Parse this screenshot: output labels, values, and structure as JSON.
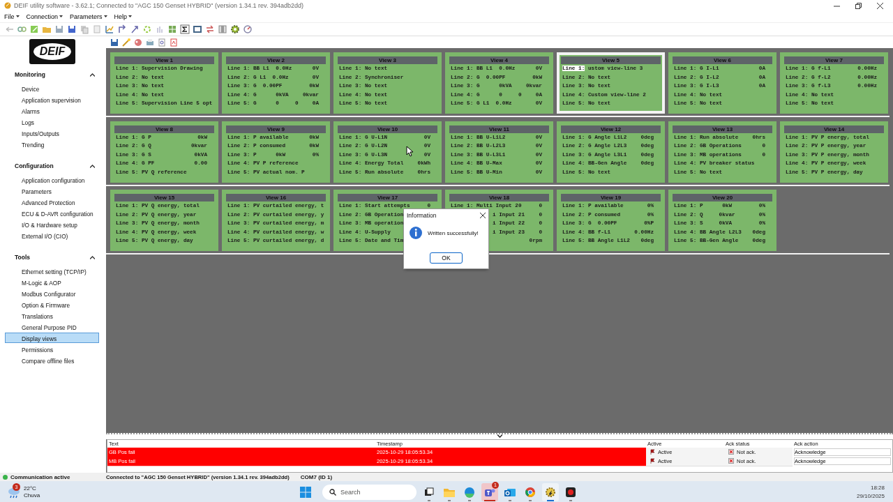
{
  "window": {
    "title": "DEIF utility software - 3.62.1; Connected to \"AGC 150 Genset HYBRID\" (version 1.34.1 rev. 394adb2dd)"
  },
  "menu": [
    "File",
    "Connection",
    "Parameters",
    "Help"
  ],
  "sidebar": {
    "logo": "DEIF",
    "sections": [
      {
        "title": "Monitoring",
        "expanded": true,
        "items": [
          {
            "label": "Device",
            "selected": false
          },
          {
            "label": "Application supervision",
            "selected": false
          },
          {
            "label": "Alarms",
            "selected": false
          },
          {
            "label": "Logs",
            "selected": false
          },
          {
            "label": "Inputs/Outputs",
            "selected": false
          },
          {
            "label": "Trending",
            "selected": false
          }
        ]
      },
      {
        "title": "Configuration",
        "expanded": true,
        "items": [
          {
            "label": "Application configuration",
            "selected": false
          },
          {
            "label": "Parameters",
            "selected": false
          },
          {
            "label": "Advanced Protection",
            "selected": false
          },
          {
            "label": "ECU & D-AVR configuration",
            "selected": false
          },
          {
            "label": "I/O & Hardware setup",
            "selected": false
          },
          {
            "label": "External I/O (CIO)",
            "selected": false
          }
        ]
      },
      {
        "title": "Tools",
        "expanded": true,
        "items": [
          {
            "label": "Ethernet setting (TCP/IP)",
            "selected": false
          },
          {
            "label": "M-Logic & AOP",
            "selected": false
          },
          {
            "label": "Modbus Configurator",
            "selected": false
          },
          {
            "label": "Option & Firmware",
            "selected": false
          },
          {
            "label": "Translations",
            "selected": false
          },
          {
            "label": "General Purpose PID",
            "selected": false
          },
          {
            "label": "Display views",
            "selected": true
          },
          {
            "label": "Permissions",
            "selected": false
          },
          {
            "label": "Compare offline files",
            "selected": false
          }
        ]
      }
    ]
  },
  "view_rows": [
    [
      {
        "title": "View 1",
        "selected": false,
        "lines": [
          {
            "label": "Line 1:",
            "text": "Supervision Drawing",
            "selected": false
          },
          {
            "label": "Line 2:",
            "text": "No text",
            "selected": false
          },
          {
            "label": "Line 3:",
            "text": "No text",
            "selected": false
          },
          {
            "label": "Line 4:",
            "text": "No text",
            "selected": false
          },
          {
            "label": "Line 5:",
            "text": "Supervision Line 5 opt",
            "selected": false
          }
        ]
      },
      {
        "title": "View 2",
        "selected": false,
        "lines": [
          {
            "label": "Line 1:",
            "text": "BB L1  0.0Hz",
            "value": "0V",
            "selected": false
          },
          {
            "label": "Line 2:",
            "text": "G L1  0.0Hz",
            "value": "0V",
            "selected": false
          },
          {
            "label": "Line 3:",
            "text": "G  0.00PF",
            "value": "0kW",
            "selected": false
          },
          {
            "label": "Line 4:",
            "text": "G      0kVA",
            "value": "0kvar",
            "selected": false
          },
          {
            "label": "Line 5:",
            "text": "G      0     0",
            "value": "0A",
            "selected": false
          }
        ]
      },
      {
        "title": "View 3",
        "selected": false,
        "lines": [
          {
            "label": "Line 1:",
            "text": "No text",
            "selected": false
          },
          {
            "label": "Line 2:",
            "text": "Synchroniser",
            "selected": false
          },
          {
            "label": "Line 3:",
            "text": "No text",
            "selected": false
          },
          {
            "label": "Line 4:",
            "text": "No text",
            "selected": false
          },
          {
            "label": "Line 5:",
            "text": "No text",
            "selected": false
          }
        ]
      },
      {
        "title": "View 4",
        "selected": false,
        "lines": [
          {
            "label": "Line 1:",
            "text": "BB L1  0.0Hz",
            "value": "0V",
            "selected": false
          },
          {
            "label": "Line 2:",
            "text": "G  0.00PF",
            "value": "0kW",
            "selected": false
          },
          {
            "label": "Line 3:",
            "text": "G      0kVA",
            "value": "0kvar",
            "selected": false
          },
          {
            "label": "Line 4:",
            "text": "G      0     0",
            "value": "0A",
            "selected": false
          },
          {
            "label": "Line 5:",
            "text": "G L1  0.0Hz",
            "value": "0V",
            "selected": false
          }
        ]
      },
      {
        "title": "View 5",
        "selected": true,
        "lines": [
          {
            "label": "Line 1:",
            "text": "ustom view-line 3",
            "selected": true
          },
          {
            "label": "Line 2:",
            "text": "No text",
            "selected": false
          },
          {
            "label": "Line 3:",
            "text": "No text",
            "selected": false
          },
          {
            "label": "Line 4:",
            "text": "Custom view-line 2",
            "selected": false
          },
          {
            "label": "Line 5:",
            "text": "No text",
            "selected": false
          }
        ]
      },
      {
        "title": "View 6",
        "selected": false,
        "lines": [
          {
            "label": "Line 1:",
            "text": "G I-L1",
            "value": "0A",
            "selected": false
          },
          {
            "label": "Line 2:",
            "text": "G I-L2",
            "value": "0A",
            "selected": false
          },
          {
            "label": "Line 3:",
            "text": "G I-L3",
            "value": "0A",
            "selected": false
          },
          {
            "label": "Line 4:",
            "text": "No text",
            "selected": false
          },
          {
            "label": "Line 5:",
            "text": "No text",
            "selected": false
          }
        ]
      },
      {
        "title": "View 7",
        "selected": false,
        "lines": [
          {
            "label": "Line 1:",
            "text": "G f-L1",
            "value": "0.00Hz",
            "selected": false
          },
          {
            "label": "Line 2:",
            "text": "G f-L2",
            "value": "0.00Hz",
            "selected": false
          },
          {
            "label": "Line 3:",
            "text": "G f-L3",
            "value": "0.00Hz",
            "selected": false
          },
          {
            "label": "Line 4:",
            "text": "No text",
            "selected": false
          },
          {
            "label": "Line 5:",
            "text": "No text",
            "selected": false
          }
        ]
      }
    ],
    [
      {
        "title": "View 8",
        "selected": false,
        "lines": [
          {
            "label": "Line 1:",
            "text": "G P",
            "value": "0kW",
            "selected": false
          },
          {
            "label": "Line 2:",
            "text": "G Q",
            "value": "0kvar",
            "selected": false
          },
          {
            "label": "Line 3:",
            "text": "G S",
            "value": "0kVA",
            "selected": false
          },
          {
            "label": "Line 4:",
            "text": "G PF",
            "value": "0.00",
            "selected": false
          },
          {
            "label": "Line 5:",
            "text": "PV Q reference",
            "selected": false
          }
        ]
      },
      {
        "title": "View 9",
        "selected": false,
        "lines": [
          {
            "label": "Line 1:",
            "text": "P available",
            "value": "0kW",
            "selected": false
          },
          {
            "label": "Line 2:",
            "text": "P consumed",
            "value": "0kW",
            "selected": false
          },
          {
            "label": "Line 3:",
            "text": "P      0kW",
            "value": "0%",
            "selected": false
          },
          {
            "label": "Line 4:",
            "text": "PV P reference",
            "selected": false
          },
          {
            "label": "Line 5:",
            "text": "PV actual nom. P",
            "selected": false
          }
        ]
      },
      {
        "title": "View 10",
        "selected": false,
        "lines": [
          {
            "label": "Line 1:",
            "text": "G U-L1N",
            "value": "0V",
            "selected": false
          },
          {
            "label": "Line 2:",
            "text": "G U-L2N",
            "value": "0V",
            "selected": false
          },
          {
            "label": "Line 3:",
            "text": "G U-L3N",
            "value": "0V",
            "selected": false
          },
          {
            "label": "Line 4:",
            "text": "Energy Total",
            "value": "0kWh",
            "selected": false
          },
          {
            "label": "Line 5:",
            "text": "Run absolute",
            "value": "0hrs",
            "selected": false
          }
        ]
      },
      {
        "title": "View 11",
        "selected": false,
        "lines": [
          {
            "label": "Line 1:",
            "text": "BB U-L1L2",
            "value": "0V",
            "selected": false
          },
          {
            "label": "Line 2:",
            "text": "BB U-L2L3",
            "value": "0V",
            "selected": false
          },
          {
            "label": "Line 3:",
            "text": "BB U-L3L1",
            "value": "0V",
            "selected": false
          },
          {
            "label": "Line 4:",
            "text": "BB U-Max",
            "value": "0V",
            "selected": false
          },
          {
            "label": "Line 5:",
            "text": "BB U-Min",
            "value": "0V",
            "selected": false
          }
        ]
      },
      {
        "title": "View 12",
        "selected": false,
        "lines": [
          {
            "label": "Line 1:",
            "text": "G Angle L1L2",
            "value": "0deg",
            "selected": false
          },
          {
            "label": "Line 2:",
            "text": "G Angle L2L3",
            "value": "0deg",
            "selected": false
          },
          {
            "label": "Line 3:",
            "text": "G Angle L3L1",
            "value": "0deg",
            "selected": false
          },
          {
            "label": "Line 4:",
            "text": "BB-Gen Angle",
            "value": "0deg",
            "selected": false
          },
          {
            "label": "Line 5:",
            "text": "No text",
            "selected": false
          }
        ]
      },
      {
        "title": "View 13",
        "selected": false,
        "lines": [
          {
            "label": "Line 1:",
            "text": "Run absolute",
            "value": "0hrs",
            "selected": false
          },
          {
            "label": "Line 2:",
            "text": "GB Operations",
            "value": "0",
            "selected": false
          },
          {
            "label": "Line 3:",
            "text": "MB operations",
            "value": "0",
            "selected": false
          },
          {
            "label": "Line 4:",
            "text": "PV breaker status",
            "selected": false
          },
          {
            "label": "Line 5:",
            "text": "No text",
            "selected": false
          }
        ]
      },
      {
        "title": "View 14",
        "selected": false,
        "lines": [
          {
            "label": "Line 1:",
            "text": "PV P energy, total",
            "selected": false
          },
          {
            "label": "Line 2:",
            "text": "PV P energy, year",
            "selected": false
          },
          {
            "label": "Line 3:",
            "text": "PV P energy, month",
            "selected": false
          },
          {
            "label": "Line 4:",
            "text": "PV P energy, week",
            "selected": false
          },
          {
            "label": "Line 5:",
            "text": "PV P energy, day",
            "selected": false
          }
        ]
      }
    ],
    [
      {
        "title": "View 15",
        "selected": false,
        "lines": [
          {
            "label": "Line 1:",
            "text": "PV Q energy, total",
            "selected": false
          },
          {
            "label": "Line 2:",
            "text": "PV Q energy, year",
            "selected": false
          },
          {
            "label": "Line 3:",
            "text": "PV Q energy, month",
            "selected": false
          },
          {
            "label": "Line 4:",
            "text": "PV Q energy, week",
            "selected": false
          },
          {
            "label": "Line 5:",
            "text": "PV Q energy, day",
            "selected": false
          }
        ]
      },
      {
        "title": "View 16",
        "selected": false,
        "lines": [
          {
            "label": "Line 1:",
            "text": "PV curtailed energy, t",
            "selected": false
          },
          {
            "label": "Line 2:",
            "text": "PV curtailed energy, y",
            "selected": false
          },
          {
            "label": "Line 3:",
            "text": "PV curtailed energy, m",
            "selected": false
          },
          {
            "label": "Line 4:",
            "text": "PV curtailed energy, w",
            "selected": false
          },
          {
            "label": "Line 5:",
            "text": "PV curtailed energy, d",
            "selected": false
          }
        ]
      },
      {
        "title": "View 17",
        "selected": false,
        "lines": [
          {
            "label": "Line 1:",
            "text": "Start attempts",
            "value": "0",
            "selected": false
          },
          {
            "label": "Line 2:",
            "text": "GB Operation",
            "selected": false
          },
          {
            "label": "Line 3:",
            "text": "MB operation",
            "selected": false
          },
          {
            "label": "Line 4:",
            "text": "U-Supply",
            "selected": false
          },
          {
            "label": "Line 5:",
            "text": "Date and Tim",
            "selected": false
          }
        ]
      },
      {
        "title": "View 18",
        "selected": false,
        "lines": [
          {
            "label": "Line 1:",
            "text": "Multi Input 20",
            "value": "0",
            "selected": false
          },
          {
            "text": "i Input 21",
            "value": "0",
            "selected": false
          },
          {
            "text": "i Input 22",
            "value": "0",
            "selected": false
          },
          {
            "text": "i Input 23",
            "value": "0",
            "selected": false
          },
          {
            "value": "0rpm",
            "selected": false
          }
        ]
      },
      {
        "title": "View 19",
        "selected": false,
        "lines": [
          {
            "label": "Line 1:",
            "text": "P available",
            "value": "0%",
            "selected": false
          },
          {
            "label": "Line 2:",
            "text": "P consumed",
            "value": "0%",
            "selected": false
          },
          {
            "label": "Line 3:",
            "text": "G  0.00PF",
            "value": "0%P",
            "selected": false
          },
          {
            "label": "Line 4:",
            "text": "BB f-L1",
            "value": "0.00Hz",
            "selected": false
          },
          {
            "label": "Line 5:",
            "text": "BB Angle L1L2",
            "value": "0deg",
            "selected": false
          }
        ]
      },
      {
        "title": "View 20",
        "selected": false,
        "lines": [
          {
            "label": "Line 1:",
            "text": "P      0kW",
            "value": "0%",
            "selected": false
          },
          {
            "label": "Line 2:",
            "text": "Q     0kvar",
            "value": "0%",
            "selected": false
          },
          {
            "label": "Line 3:",
            "text": "S     0kVA",
            "value": "0%",
            "selected": false
          },
          {
            "label": "Line 4:",
            "text": "BB Angle L2L3",
            "value": "0deg",
            "selected": false
          },
          {
            "label": "Line 5:",
            "text": "BB-Gen Angle",
            "value": "0deg",
            "selected": false
          }
        ]
      }
    ]
  ],
  "dialog": {
    "title": "Information",
    "message": "Written successfully!",
    "button": "OK"
  },
  "alarms": {
    "columns": [
      "Text",
      "Timestamp",
      "Active",
      "Ack status",
      "Ack action"
    ],
    "rows": [
      {
        "text": "GB Pos fail",
        "timestamp": "2025-10-29 18:05:53.34",
        "active": "Active",
        "ack_status": "Not ack.",
        "action": "Acknowledge",
        "acknowledged": false
      },
      {
        "text": "MB Pos fail",
        "timestamp": "2025-10-29 18:05:53.34",
        "active": "Active",
        "ack_status": "Not ack.",
        "action": "Acknowledge",
        "acknowledged": false
      }
    ]
  },
  "status_bar": {
    "communication": "Communication active",
    "connected": true,
    "connection": "Connected to \"AGC 150 Genset HYBRID\" (version 1.34.1 rev. 394adb2dd)",
    "port": "COM7 (ID 1)"
  },
  "taskbar": {
    "weather": {
      "temperature": "22°C",
      "condition": "Chuva",
      "badge": "3"
    },
    "search": {
      "placeholder": "Search"
    },
    "apps": [
      {
        "kind": "taskview",
        "selected": false,
        "alert": false
      },
      {
        "kind": "folder",
        "selected": false,
        "alert": false
      },
      {
        "kind": "edge",
        "selected": false,
        "alert": false
      },
      {
        "kind": "teams",
        "selected": false,
        "alert": true,
        "badge": "1"
      },
      {
        "kind": "outlook",
        "selected": false,
        "alert": false
      },
      {
        "kind": "chrome",
        "selected": false,
        "alert": false
      },
      {
        "kind": "gear",
        "selected": true,
        "alert": false
      },
      {
        "kind": "record",
        "selected": false,
        "alert": false
      }
    ],
    "time": "18:28",
    "date": "29/10/2025"
  }
}
